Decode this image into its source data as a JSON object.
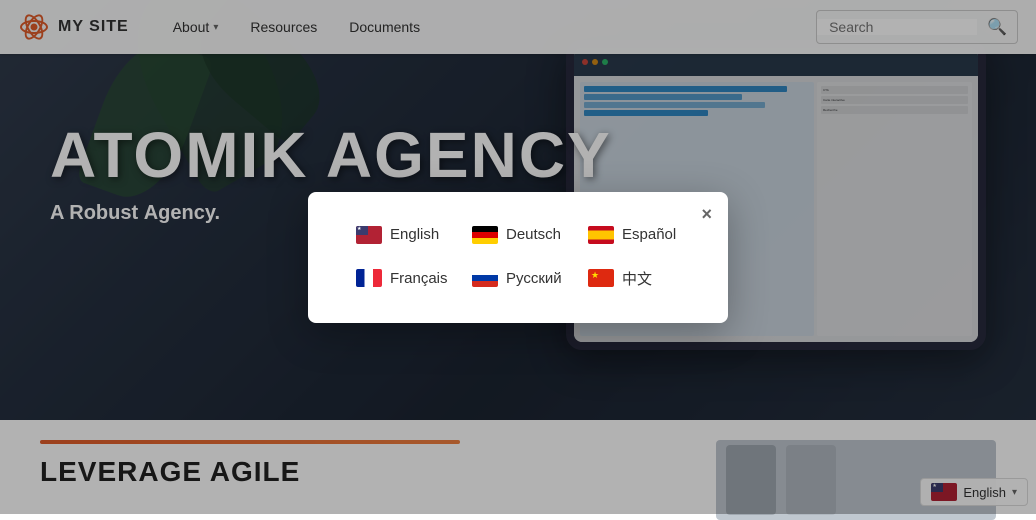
{
  "navbar": {
    "logo_text": "MY SITE",
    "links": [
      {
        "label": "About",
        "has_dropdown": true
      },
      {
        "label": "Resources",
        "has_dropdown": false
      },
      {
        "label": "Documents",
        "has_dropdown": false
      }
    ],
    "search_placeholder": "Search"
  },
  "hero": {
    "title": "ATOMIK AGENCY",
    "subtitle_prefix": "A Robust",
    "subtitle_suffix": "Agency."
  },
  "bottom": {
    "title": "LEVERAGE AGILE"
  },
  "lang_footer": {
    "label": "English"
  },
  "modal": {
    "close_label": "×",
    "languages": [
      {
        "code": "en",
        "label": "English",
        "flag_class": "flag-us"
      },
      {
        "code": "de",
        "label": "Deutsch",
        "flag_class": "flag-de"
      },
      {
        "code": "es",
        "label": "Español",
        "flag_class": "flag-es"
      },
      {
        "code": "fr",
        "label": "Français",
        "flag_class": "flag-fr"
      },
      {
        "code": "ru",
        "label": "Русский",
        "flag_class": "flag-ru"
      },
      {
        "code": "zh",
        "label": "中文",
        "flag_class": "flag-cn"
      }
    ]
  }
}
